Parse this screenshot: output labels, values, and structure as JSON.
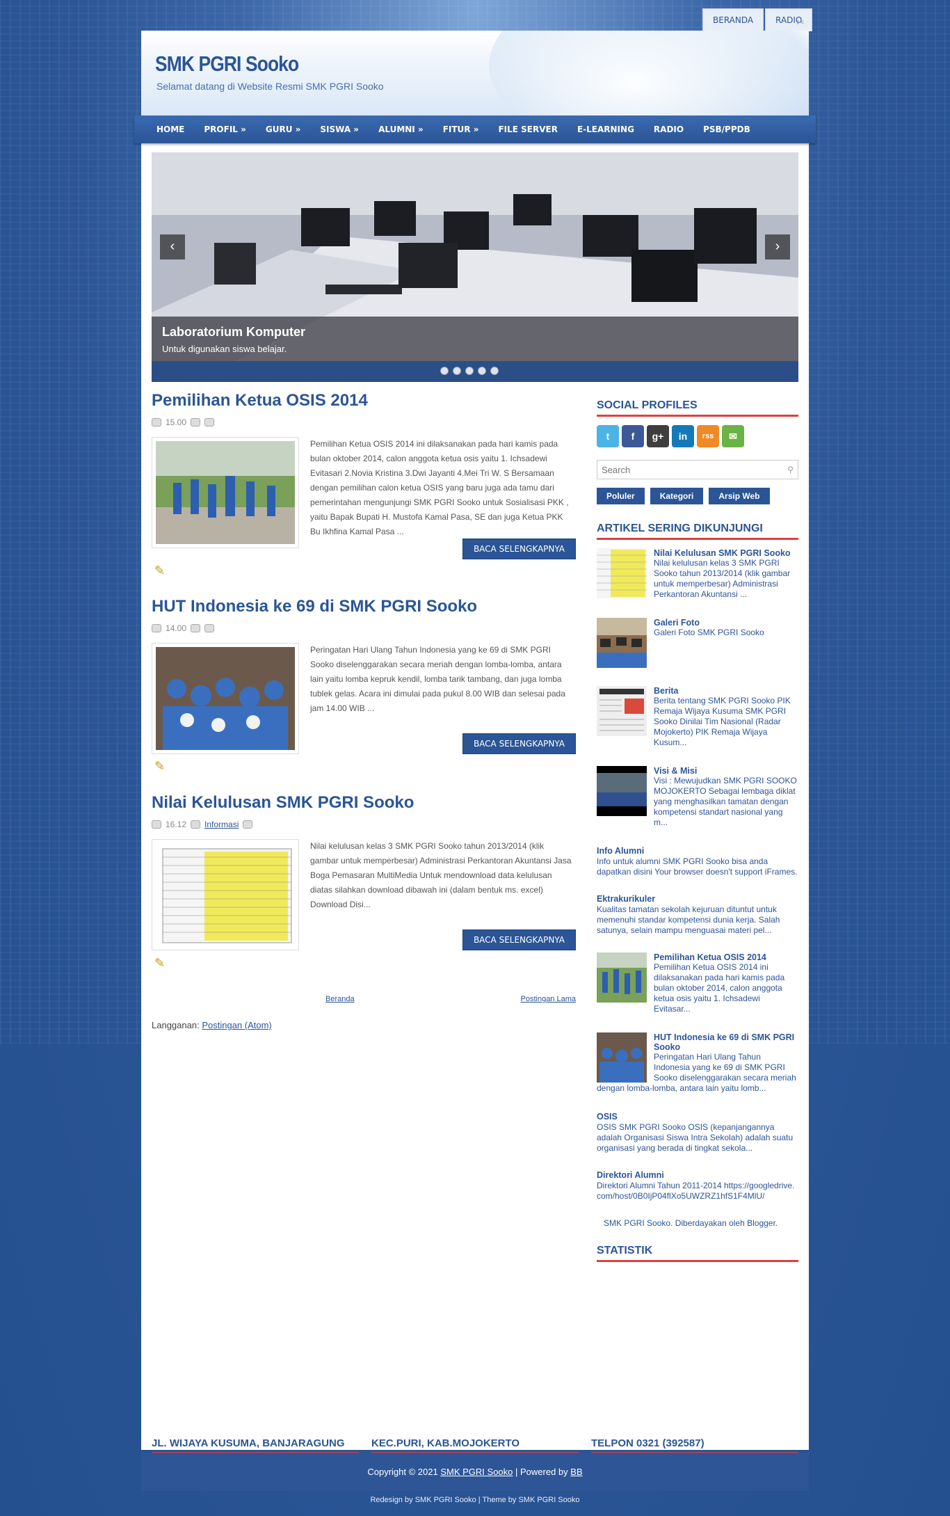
{
  "top_tabs": [
    "BERANDA",
    "RADIO"
  ],
  "site": {
    "title": "SMK PGRI Sooko",
    "description": "Selamat datang di Website Resmi SMK PGRI Sooko"
  },
  "nav": [
    "HOME",
    "PROFIL »",
    "GURU »",
    "SISWA »",
    "ALUMNI »",
    "FITUR »",
    "FILE SERVER",
    "E-LEARNING",
    "RADIO",
    "PSB/PPDB"
  ],
  "slider": {
    "caption_title": "Laboratorium Komputer",
    "caption_text": "Untuk digunakan siswa belajar.",
    "prev": "‹",
    "next": "›",
    "dots": 5
  },
  "posts": [
    {
      "title": "Pemilihan Ketua OSIS 2014",
      "time": "15.00",
      "category": "",
      "excerpt": "Pemilihan Ketua OSIS 2014 ini dilaksanakan pada hari kamis pada bulan oktober 2014, calon anggota ketua osis yaitu  1. Ichsadewi Evitasari 2.Novia Kristina 3.Dwi Jayanti 4.Mei Tri W. S Bersamaan dengan pemilihan calon ketua OSIS yang baru juga ada tamu dari pemerintahan mengunjungi SMK PGRI Sooko untuk Sosialisasi PKK , yaitu Bapak Bupati  H. Mustofa Kamal Pasa, SE dan juga Ketua PKK Bu Ikhfina Kamal Pasa ...",
      "read_more": "BACA SELENGKAPNYA"
    },
    {
      "title": "HUT Indonesia ke 69 di SMK PGRI Sooko",
      "time": "14.00",
      "category": "",
      "excerpt": "Peringatan Hari Ulang Tahun Indonesia yang ke 69 di SMK PGRI Sooko diselenggarakan secara meriah dengan lomba-lomba, antara lain yaitu lomba kepruk kendil, lomba tarik tambang, dan juga lomba tublek gelas. Acara ini dimulai pada pukul 8.00 WIB dan selesai pada jam 14.00 WIB ...",
      "read_more": "BACA SELENGKAPNYA"
    },
    {
      "title": "Nilai Kelulusan SMK PGRI Sooko",
      "time": "16.12",
      "category": "Informasi",
      "excerpt": "Nilai kelulusan kelas 3 SMK PGRI Sooko tahun 2013/2014 (klik gambar untuk memperbesar) Administrasi Perkantoran Akuntansi Jasa Boga Pemasaran MultiMedia Untuk mendownload data kelulusan diatas silahkan download dibawah ini (dalam bentuk ms. excel) Download Disi...",
      "read_more": "BACA SELENGKAPNYA"
    }
  ],
  "pager": {
    "home": "Beranda",
    "older": "Postingan Lama"
  },
  "feed": {
    "label": "Langganan:",
    "link": "Postingan (Atom)"
  },
  "sidebar": {
    "social_title": "SOCIAL PROFILES",
    "social_icons": [
      "t",
      "f",
      "g+",
      "in",
      "rss",
      "✉"
    ],
    "search_placeholder": "Search",
    "tabs": [
      "Poluler",
      "Kategori",
      "Arsip Web"
    ],
    "popular_title": "ARTIKEL SERING DIKUNJUNGI",
    "popular": [
      {
        "title": "Nilai Kelulusan SMK PGRI Sooko",
        "text": "Nilai kelulusan kelas 3 SMK PGRI Sooko tahun 2013/2014 (klik gambar untuk memperbesar) Administrasi Perkantoran Akuntansi ..."
      },
      {
        "title": "Galeri Foto",
        "text": "Galeri Foto SMK PGRI Sooko"
      },
      {
        "title": "Berita",
        "text": "Berita tentang SMK PGRI Sooko PIK Remaja Wijaya Kusuma SMK PGRI Sooko Dinilai Tim Nasional (Radar Mojokerto) PIK Remaja Wijaya Kusum..."
      },
      {
        "title": "Visi & Misi",
        "text": "Visi : Mewujudkan SMK PGRI SOOKO MOJOKERTO Sebagai lembaga diklat yang menghasilkan tamatan dengan kompetensi standart nasional yang m..."
      }
    ],
    "popular_noimg": [
      {
        "title": "Info Alumni",
        "text": "Info untuk alumni SMK PGRI Sooko bisa anda dapatkan disini Your browser doesn't support iFrames."
      },
      {
        "title": "Ektrakurikuler",
        "text": "Kualitas tamatan sekolah kejuruan dituntut untuk memenuhi standar kompetensi dunia kerja. Salah satunya, selain mampu menguasai materi pel..."
      }
    ],
    "popular2": [
      {
        "title": "Pemilihan Ketua OSIS 2014",
        "text": "Pemilihan Ketua OSIS 2014 ini dilaksanakan pada hari kamis pada bulan oktober 2014, calon anggota ketua osis yaitu  1. Ichsadewi Evitasar..."
      },
      {
        "title": "HUT Indonesia ke 69 di SMK PGRI Sooko",
        "text": "Peringatan Hari Ulang Tahun Indonesia yang ke 69 di SMK PGRI Sooko diselenggarakan secara meriah dengan lomba-lomba, antara lain yaitu lomb..."
      }
    ],
    "popular_noimg2": [
      {
        "title": "OSIS",
        "text": "OSIS SMK PGRI Sooko OSIS (kepanjangannya adalah Organisasi Siswa Intra Sekolah) adalah suatu organisasi yang berada di tingkat sekola..."
      },
      {
        "title": "Direktori Alumni",
        "text": "Direktori Alumni Tahun 2011-2014 https://googledrive.com/host/0B0IjP04flXo5UWZRZ1hfS1F4MlU/"
      }
    ],
    "attribution": "SMK PGRI Sooko. Diberdayakan oleh Blogger.",
    "stats_title": "STATISTIK"
  },
  "footer_cols": [
    "JL. WIJAYA KUSUMA, BANJARAGUNG",
    "KEC.PURI, KAB.MOJOKERTO",
    "TELPON 0321 (392587)"
  ],
  "copyright": {
    "prefix": "Copyright © 2021",
    "site": "SMK PGRI Sooko",
    "mid": "| Powered by",
    "bb": "BB"
  },
  "credits": "Redesign by SMK PGRI Sooko | Theme by SMK PGRI Sooko"
}
